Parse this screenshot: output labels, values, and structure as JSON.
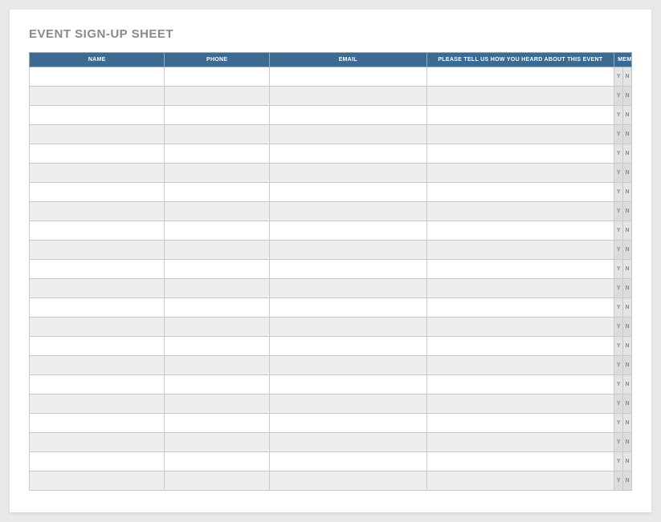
{
  "title": "EVENT SIGN-UP SHEET",
  "headers": {
    "name": "NAME",
    "phone": "PHONE",
    "email": "EMAIL",
    "heard": "PLEASE TELL US HOW YOU HEARD ABOUT THIS EVENT",
    "member": "MEMBER"
  },
  "member_options": {
    "yes": "Y",
    "no": "N"
  },
  "row_count": 22,
  "colors": {
    "header_bg": "#3b6a93",
    "header_text": "#ffffff",
    "title_text": "#8a8a8a",
    "row_alt_bg": "#eeeeee",
    "member_cell_bg": "#e4e4e4",
    "border": "#c8c8c8"
  }
}
